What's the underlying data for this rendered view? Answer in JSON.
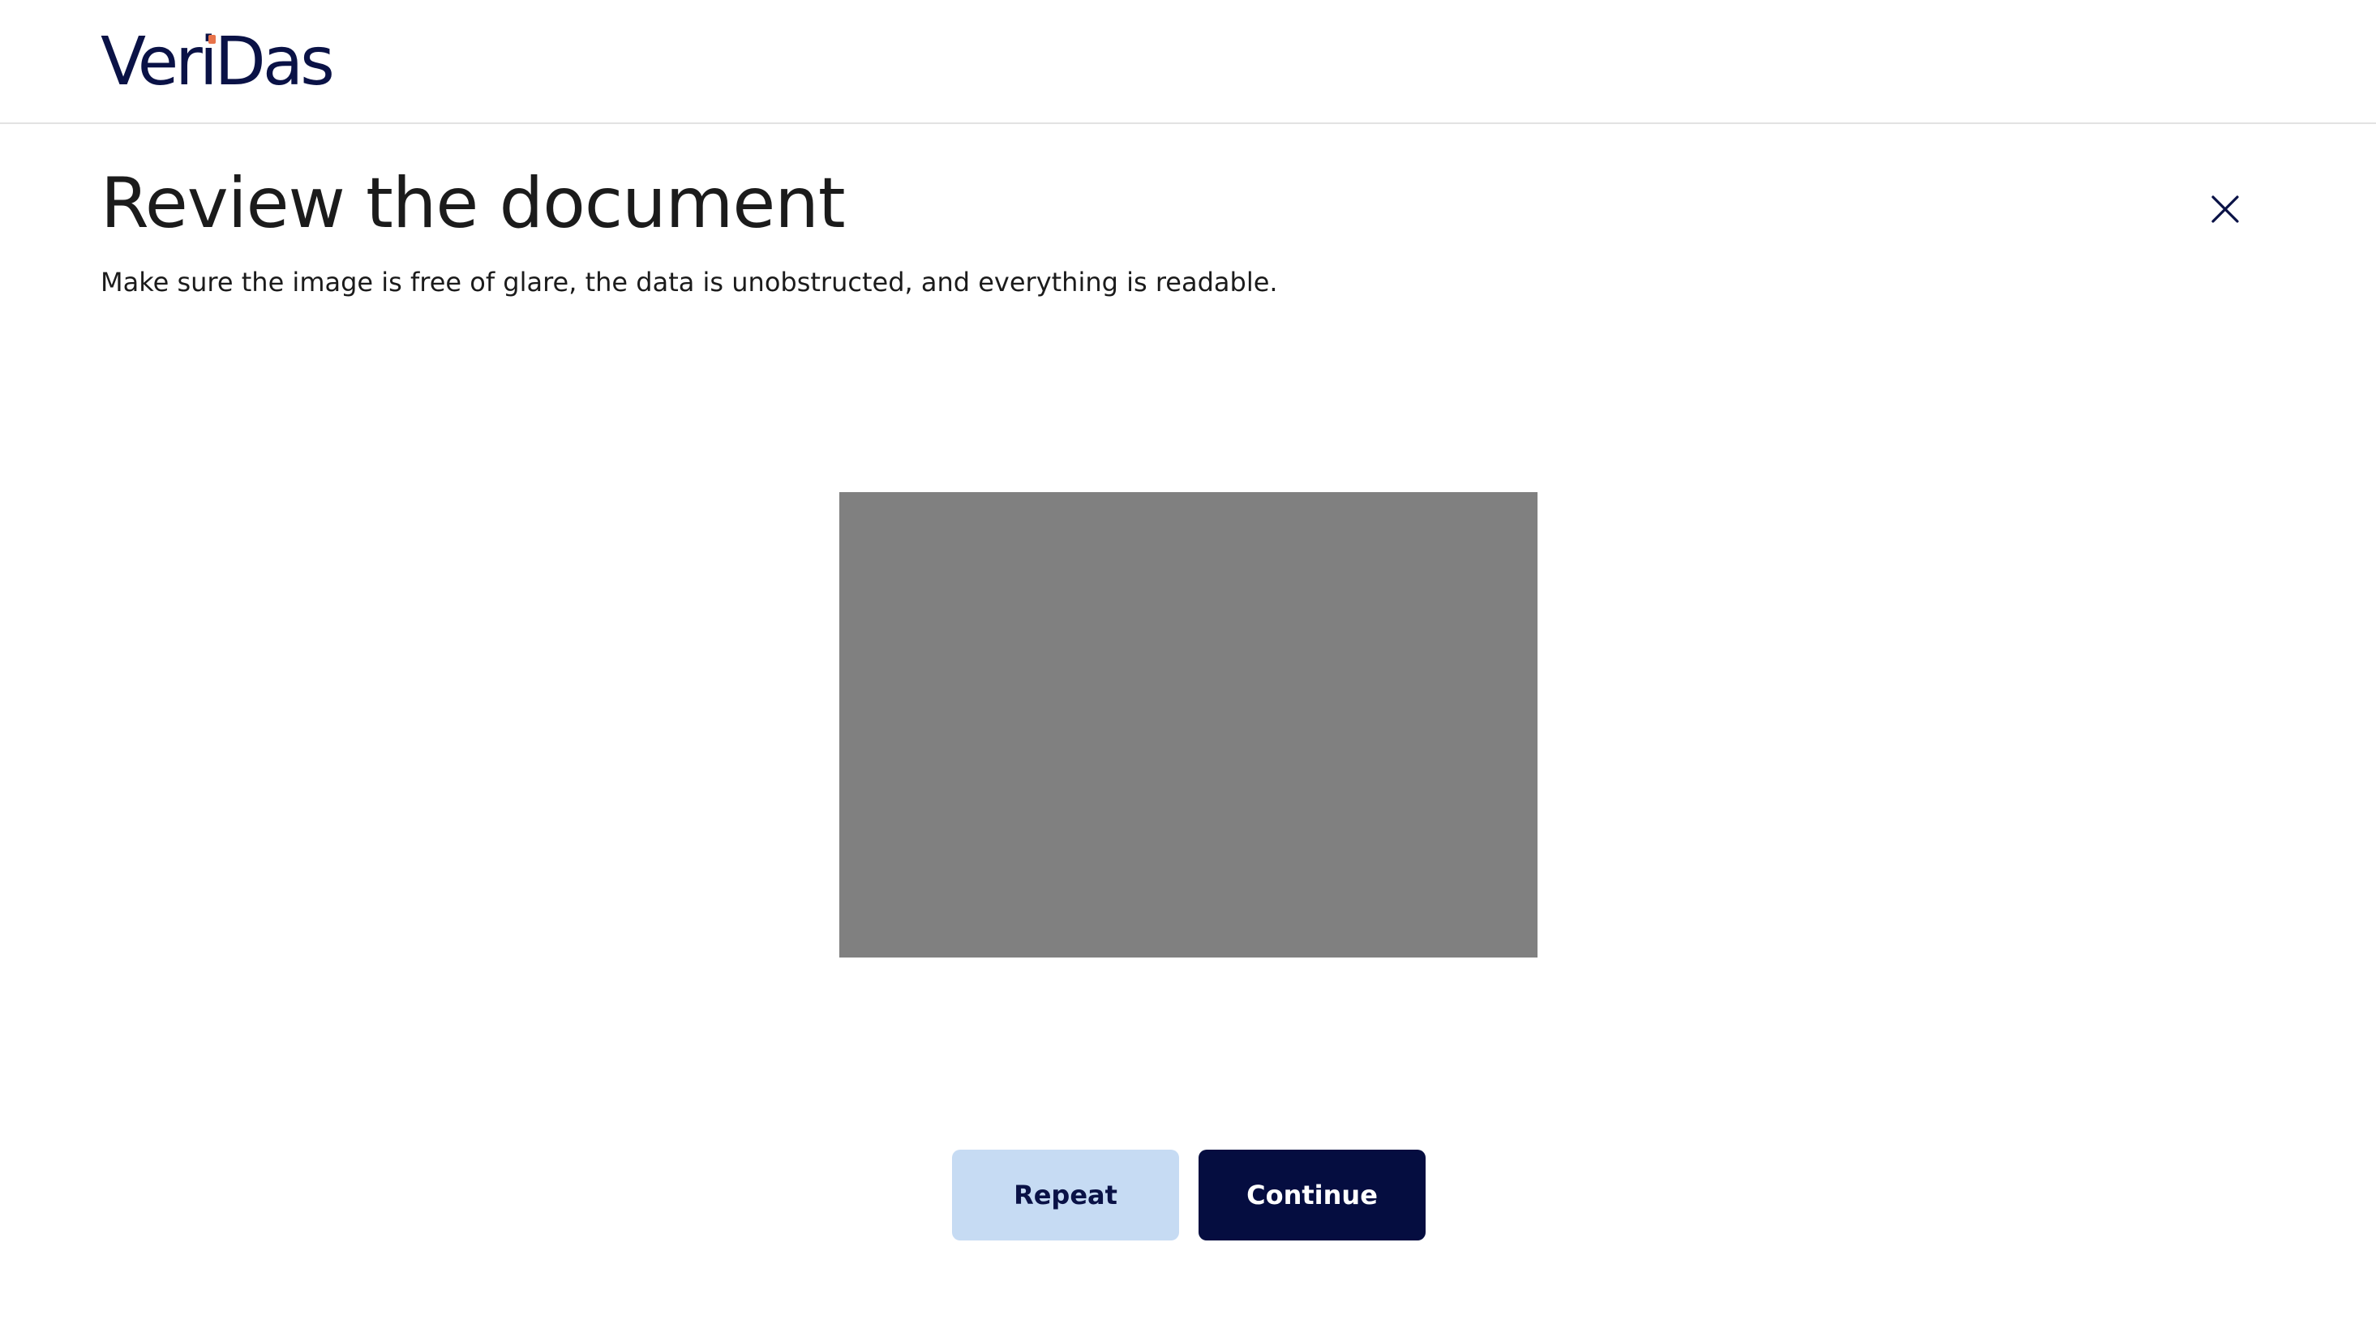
{
  "header": {
    "logo_text": "VeriDas",
    "logo_accent_color": "#e8734a",
    "brand_color": "#0a1246"
  },
  "main": {
    "title": "Review the document",
    "subtitle": "Make sure the image is free of glare, the data is unobstructed, and everything is readable.",
    "close_icon": "close-icon",
    "document_preview_color": "#808080"
  },
  "actions": {
    "repeat_label": "Repeat",
    "continue_label": "Continue",
    "repeat_bg": "#c6dbf3",
    "continue_bg": "#050d40"
  }
}
